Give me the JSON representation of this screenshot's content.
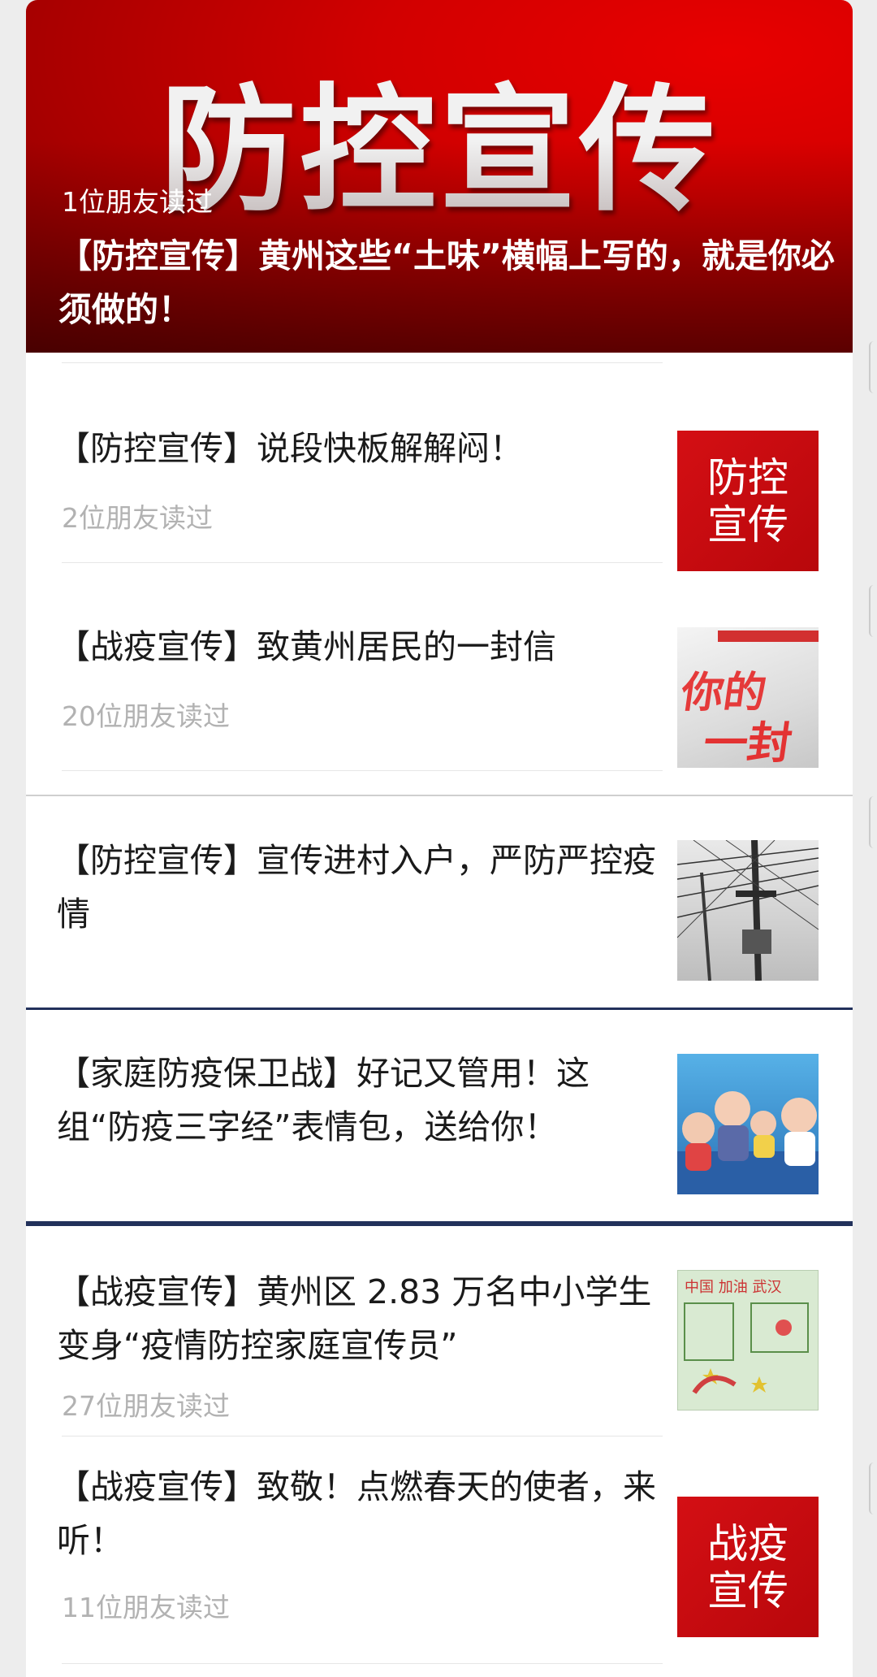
{
  "hero": {
    "art_text": "防控宣传",
    "read_count": "1位朋友读过",
    "title": "【防控宣传】黄州这些“土味”横幅上写的，就是你必须做的！"
  },
  "articles": [
    {
      "title": "【防控宣传】说段快板解解闷！",
      "read_count": "2位朋友读过",
      "thumb_line1": "防控",
      "thumb_line2": "宣传",
      "thumb_icon": "red-badge-image"
    },
    {
      "title": "【战疫宣传】致黄州居民的一封信",
      "read_count": "20位朋友读过",
      "thumb_line1": "你的",
      "thumb_line2": "一封信",
      "thumb_icon": "letter-image"
    },
    {
      "title": "【防控宣传】宣传进村入户，严防严控疫情",
      "thumb_icon": "power-lines-image"
    },
    {
      "title": "【家庭防疫保卫战】好记又管用！这组“防疫三字经”表情包，送给你！",
      "thumb_icon": "cartoon-family-image"
    },
    {
      "title": "【战疫宣传】黄州区 2.83 万名中小学生变身“疫情防控家庭宣传员”",
      "read_count": "27位朋友读过",
      "thumb_line1": "中国 加油 武汉",
      "thumb_icon": "child-drawing-image"
    },
    {
      "title": "【战疫宣传】致敬！点燃春天的使者，来听！",
      "read_count": "11位朋友读过",
      "thumb_line1": "战疫",
      "thumb_line2": "宣传",
      "thumb_icon": "red-badge-image"
    }
  ],
  "colors": {
    "hero_red": "#d20000",
    "badge_red": "#c80b10",
    "divider_navy": "#22315b",
    "meta_grey": "#b2b2b2"
  }
}
